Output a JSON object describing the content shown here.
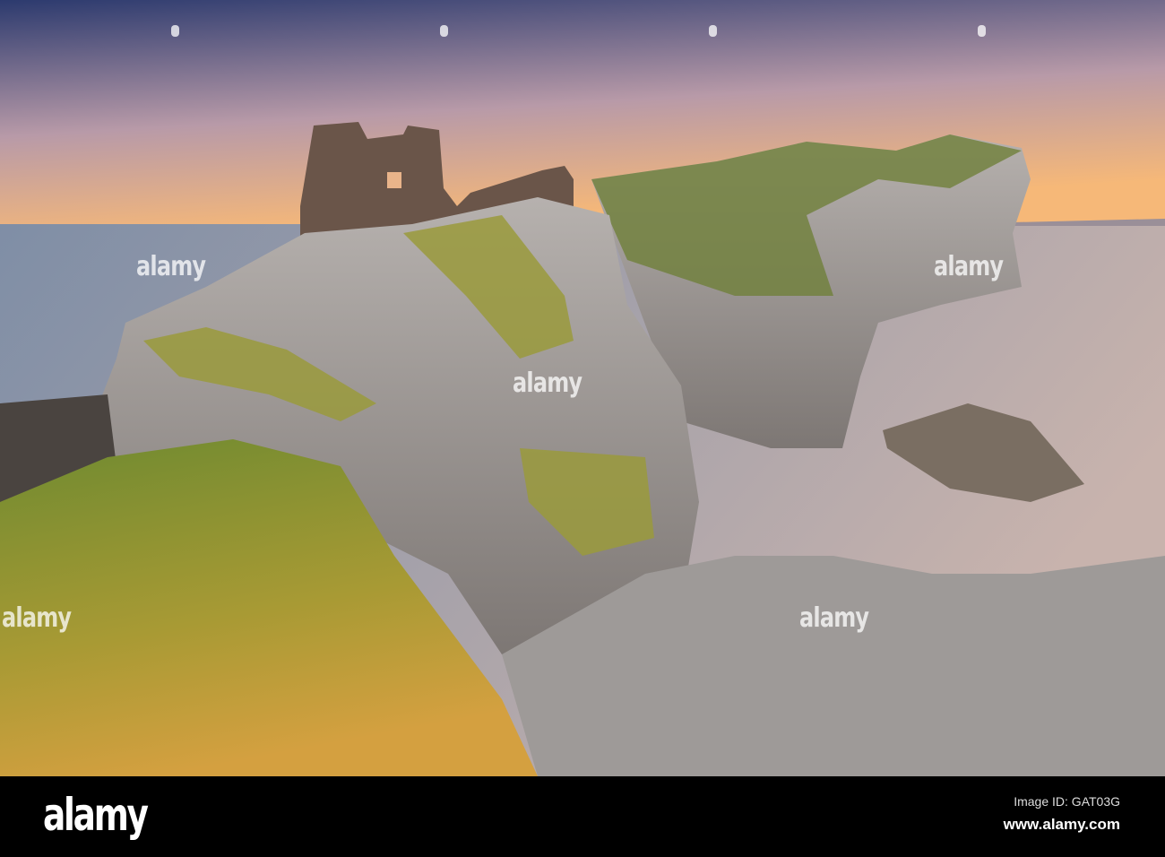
{
  "photo": {
    "subject": "Coastal cliffs with castle ruins at sunset",
    "colors": {
      "sky_top": "#2c3a6e",
      "sky_mid": "#b89aa8",
      "sky_horizon": "#f6b878",
      "sea": "#8a96a8",
      "rock": "#a9a8a8",
      "grass": "#8a9a3a",
      "grass_sunlit": "#c8a240"
    }
  },
  "watermark": {
    "text": "alamy"
  },
  "footer": {
    "logo": "alamy",
    "image_id": "Image ID: GAT03G",
    "url": "www.alamy.com"
  }
}
